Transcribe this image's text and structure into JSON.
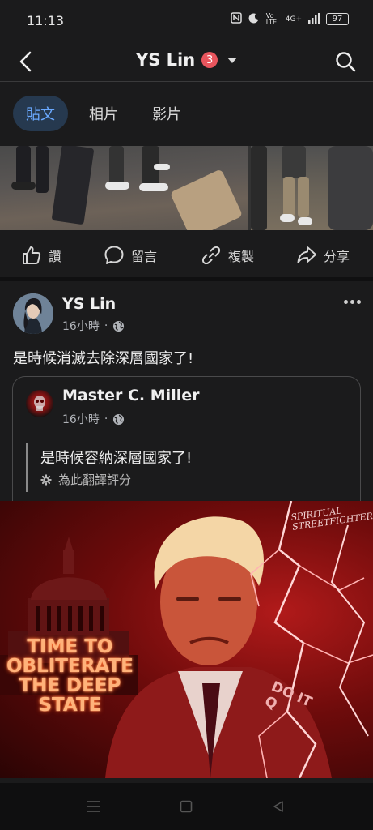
{
  "status_bar": {
    "time": "11:13",
    "network_label": "Vo LTE",
    "signal_label": "4G+",
    "battery": "97"
  },
  "header": {
    "title": "YS Lin",
    "notification_count": "3"
  },
  "tabs": [
    {
      "label": "貼文",
      "active": true
    },
    {
      "label": "相片",
      "active": false
    },
    {
      "label": "影片",
      "active": false
    }
  ],
  "actions": {
    "like": "讚",
    "comment": "留言",
    "copy": "複製",
    "share": "分享"
  },
  "post": {
    "author": "YS Lin",
    "time": "16小時",
    "meta_separator": "·",
    "text": "是時候消滅去除深層國家了!",
    "shared": {
      "author": "Master C. Miller",
      "time": "16小時",
      "meta_separator": "·",
      "text": "是時候容納深層國家了!",
      "translate_label": "為此翻譯評分"
    },
    "image": {
      "headline": "TIME TO\nOBLITERATE\nTHE DEEP\nSTATE",
      "corner_text": "SPIRITUAL\nSTREETFIGHTER",
      "side_text": "DO IT\nQ"
    }
  },
  "colors": {
    "background": "#1b1b1c",
    "accent": "#6aa9ff",
    "active_tab_bg": "#26394f",
    "badge": "#e8555d"
  }
}
